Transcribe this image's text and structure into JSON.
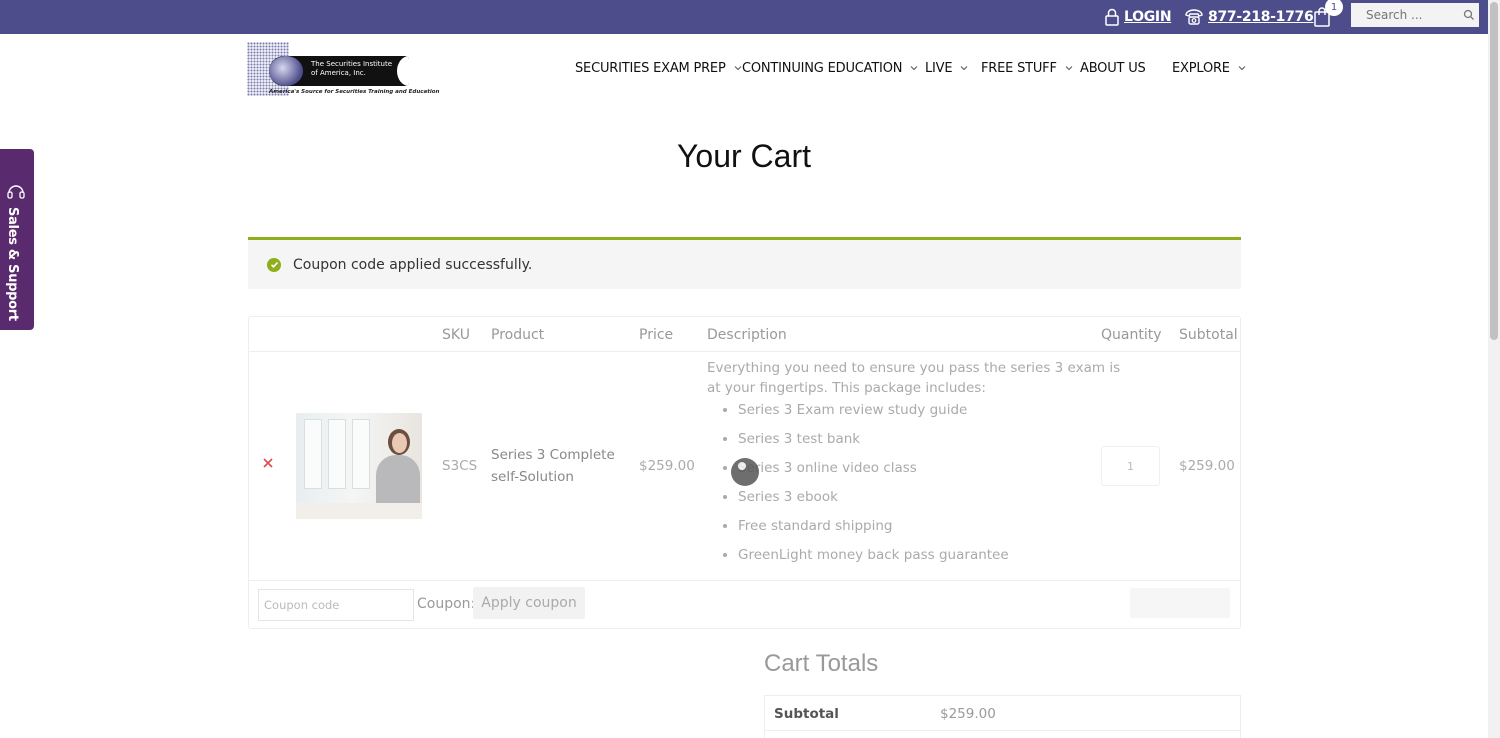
{
  "topbar": {
    "login_label": "LOGIN",
    "phone": "877-218-1776",
    "cart_count": "1",
    "search_placeholder": "Search ...",
    "bg_color": "#4c4d8a"
  },
  "logo": {
    "line1": "The Securities Institute",
    "line2": "of America, Inc.",
    "tagline": "America's Source for Securities Training and Education"
  },
  "nav": {
    "items": [
      {
        "label": "SECURITIES EXAM PREP",
        "has_dropdown": true
      },
      {
        "label": "CONTINUING EDUCATION",
        "has_dropdown": true
      },
      {
        "label": "LIVE",
        "has_dropdown": true
      },
      {
        "label": "FREE STUFF",
        "has_dropdown": true
      },
      {
        "label": "ABOUT US",
        "has_dropdown": false
      },
      {
        "label": "EXPLORE",
        "has_dropdown": true
      }
    ]
  },
  "side_tab": {
    "label": "Sales & Support",
    "color": "#5a2a6e"
  },
  "page": {
    "title": "Your Cart"
  },
  "notice": {
    "message": "Coupon code applied successfully.",
    "color": "#8fae1b"
  },
  "cart": {
    "headers": {
      "sku": "SKU",
      "product": "Product",
      "price": "Price",
      "description": "Description",
      "quantity": "Quantity",
      "subtotal": "Subtotal"
    },
    "item": {
      "sku": "S3CS",
      "product_line1": "Series 3 Complete",
      "product_line2": "self-Solution",
      "price": "$259.00",
      "description_intro_line1": "Everything you need to ensure you pass the series 3 exam is",
      "description_intro_line2": "at your fingertips. This package includes:",
      "includes": [
        "Series 3 Exam review study guide",
        "Series 3 test bank",
        "Series 3 online video class",
        "Series 3 ebook",
        "Free standard shipping",
        "GreenLight money back pass guarantee"
      ],
      "quantity": "1",
      "subtotal": "$259.00"
    },
    "coupon_placeholder": "Coupon code",
    "coupon_label": "Coupon:",
    "apply_label": "Apply coupon"
  },
  "totals": {
    "title": "Cart Totals",
    "subtotal_label": "Subtotal",
    "subtotal_value": "$259.00"
  }
}
